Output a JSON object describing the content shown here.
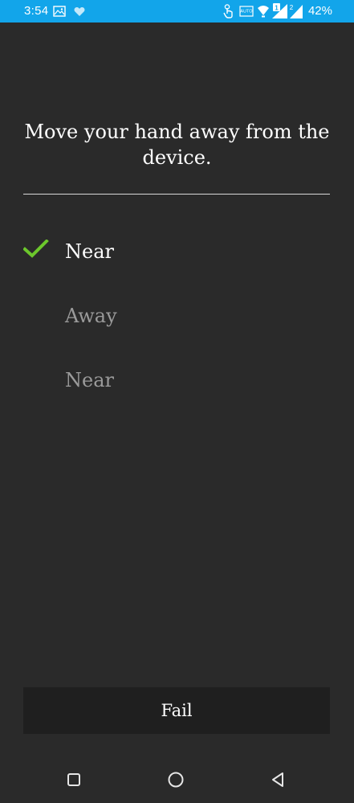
{
  "status_bar": {
    "time": "3:54",
    "battery": "42%",
    "background_color": "#12a5ea",
    "icons": [
      "image-icon",
      "heart-icon",
      "touch-icon",
      "auto-icon",
      "wifi-icon",
      "signal-icon-1",
      "signal-icon-2"
    ],
    "sim1_badge": "1",
    "sim2_badge": "2",
    "auto_label": "AUTO"
  },
  "instruction": {
    "text": "Move your hand away from the device."
  },
  "steps": [
    {
      "label": "Near",
      "state": "done"
    },
    {
      "label": "Away",
      "state": "pending"
    },
    {
      "label": "Near",
      "state": "pending"
    }
  ],
  "check_color": "#6cc72c",
  "fail_button": {
    "label": "Fail"
  },
  "nav_bar": {
    "icons": [
      "recents-icon",
      "home-icon",
      "back-icon"
    ]
  }
}
